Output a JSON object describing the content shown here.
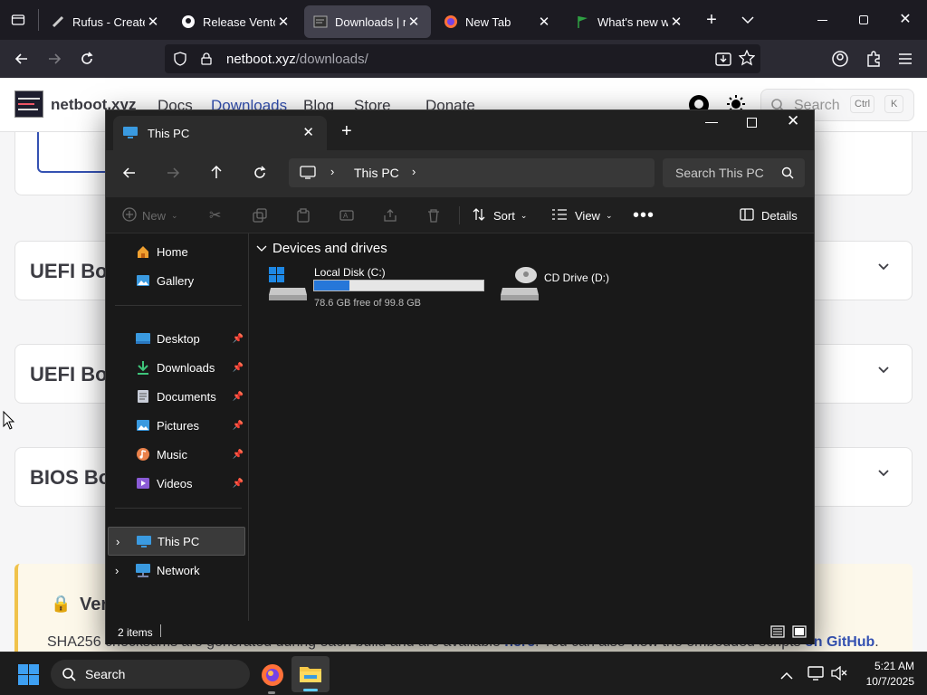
{
  "browser": {
    "tabs": [
      {
        "label": "Rufus - Create b",
        "icon": "rufus-icon"
      },
      {
        "label": "Release Ventoy",
        "icon": "github-icon"
      },
      {
        "label": "Downloads | net",
        "icon": "netboot-icon"
      },
      {
        "label": "New Tab",
        "icon": "firefox-icon"
      },
      {
        "label": "What's new with",
        "icon": "flag-icon"
      }
    ],
    "url_host": "netboot.xyz",
    "url_path": "/downloads/"
  },
  "site": {
    "brand": "netboot.xyz",
    "nav": [
      "Docs",
      "Downloads",
      "Blog",
      "Store",
      "Donate"
    ],
    "search_placeholder": "Search",
    "search_kbd": [
      "Ctrl",
      "K"
    ],
    "sections": [
      "UEFI Bo",
      "UEFI Bo",
      "BIOS Bo"
    ],
    "verify_title": "Ver",
    "footer_text_a": "SHA256 checksums are generated during each build and are available ",
    "footer_link_a": "here",
    "footer_text_b": ". You can also view the embedded scripts ",
    "footer_link_b": "on GitHub",
    "footer_text_c": ".",
    "accent": "#3451b2"
  },
  "explorer": {
    "tab_title": "This PC",
    "breadcrumb": "This PC",
    "search_placeholder": "Search This PC",
    "toolbar": {
      "new": "New",
      "sort": "Sort",
      "view": "View",
      "details": "Details"
    },
    "sidebar": {
      "home": "Home",
      "gallery": "Gallery",
      "pinned": [
        "Desktop",
        "Downloads",
        "Documents",
        "Pictures",
        "Music",
        "Videos"
      ],
      "this_pc": "This PC",
      "network": "Network"
    },
    "section_title": "Devices and drives",
    "drives": [
      {
        "name": "Local Disk (C:)",
        "free": "78.6 GB free of 99.8 GB",
        "used_fraction": 0.21
      },
      {
        "name": "CD Drive (D:)"
      }
    ],
    "status": "2 items"
  },
  "taskbar": {
    "search": "Search",
    "time": "5:21 AM",
    "date": "10/7/2025"
  }
}
